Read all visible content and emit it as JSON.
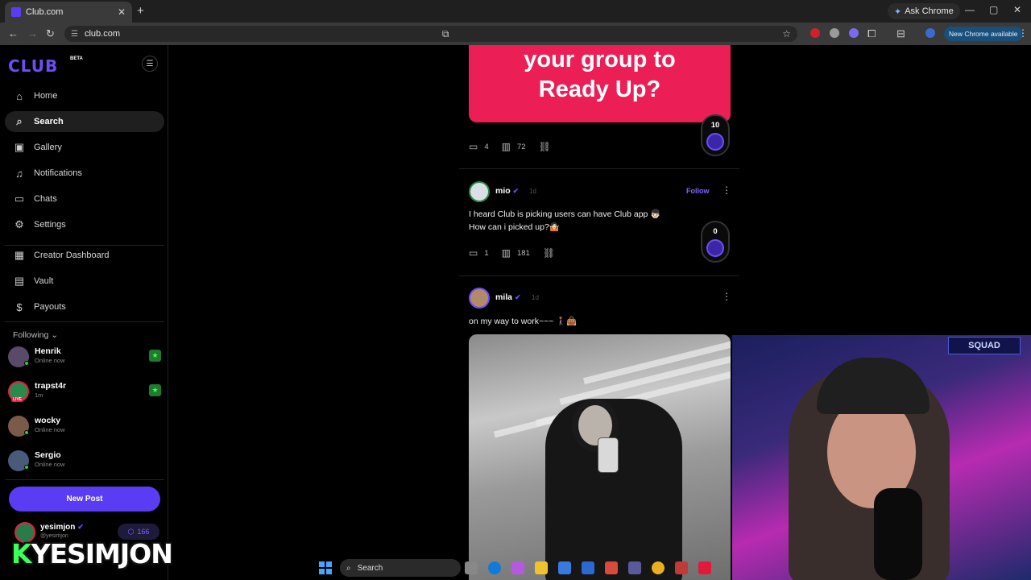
{
  "browser": {
    "tab_title": "Club.com",
    "tab_close": "✕",
    "new_tab": "+",
    "ask_chrome": "Ask Chrome",
    "url": "club.com",
    "new_chrome_available": "New Chrome available",
    "window_controls": [
      "—",
      "▢",
      "✕"
    ]
  },
  "sidebar": {
    "logo": "CLUB",
    "beta": "BETA",
    "nav": [
      {
        "label": "Home",
        "icon": "home-icon",
        "glyph": "⌂"
      },
      {
        "label": "Search",
        "icon": "search-icon",
        "glyph": "⌕",
        "active": true
      },
      {
        "label": "Gallery",
        "icon": "gallery-icon",
        "glyph": "▣"
      },
      {
        "label": "Notifications",
        "icon": "bell-icon",
        "glyph": "♫"
      },
      {
        "label": "Chats",
        "icon": "chat-icon",
        "glyph": "▭"
      },
      {
        "label": "Settings",
        "icon": "gear-icon",
        "glyph": "⚙"
      },
      {
        "label": "Creator Dashboard",
        "icon": "dashboard-icon",
        "glyph": "▦"
      },
      {
        "label": "Vault",
        "icon": "vault-icon",
        "glyph": "▤"
      },
      {
        "label": "Payouts",
        "icon": "dollar-icon",
        "glyph": "$"
      }
    ],
    "following_label": "Following ⌄",
    "following": [
      {
        "name": "Henrik",
        "status": "Online now",
        "starred": true,
        "color": "#5a4a6a"
      },
      {
        "name": "trapst4r",
        "status": "1m",
        "starred": true,
        "live": true,
        "live_label": "LIVE",
        "color": "#2a8a4a"
      },
      {
        "name": "wocky",
        "status": "Online now",
        "starred": false,
        "color": "#7a5a48"
      },
      {
        "name": "Sergio",
        "status": "Online now",
        "starred": false,
        "color": "#4a5a7a"
      }
    ],
    "new_post": "New Post",
    "me": {
      "name": "yesimjon",
      "handle": "@yesimjon",
      "points": "166"
    }
  },
  "overlay_name": {
    "k": "K",
    "rest": "YESIMJON"
  },
  "feed": {
    "banner_text": "your group to\nReady Up?",
    "post0": {
      "comments": "4",
      "views": "72",
      "score": "10"
    },
    "post1": {
      "user": "mio",
      "time": "1d",
      "follow": "Follow",
      "text": "I heard Club is picking users can have Club app 👦🏻\nHow can i picked up?🤷🏻",
      "comments": "1",
      "views": "181",
      "score": "0"
    },
    "post2": {
      "user": "mila",
      "time": "1d",
      "text": "on my way to work~~~ 🚶‍♀️👜"
    }
  },
  "webcam": {
    "sign": "SQUAD"
  },
  "taskbar": {
    "search": "Search"
  }
}
